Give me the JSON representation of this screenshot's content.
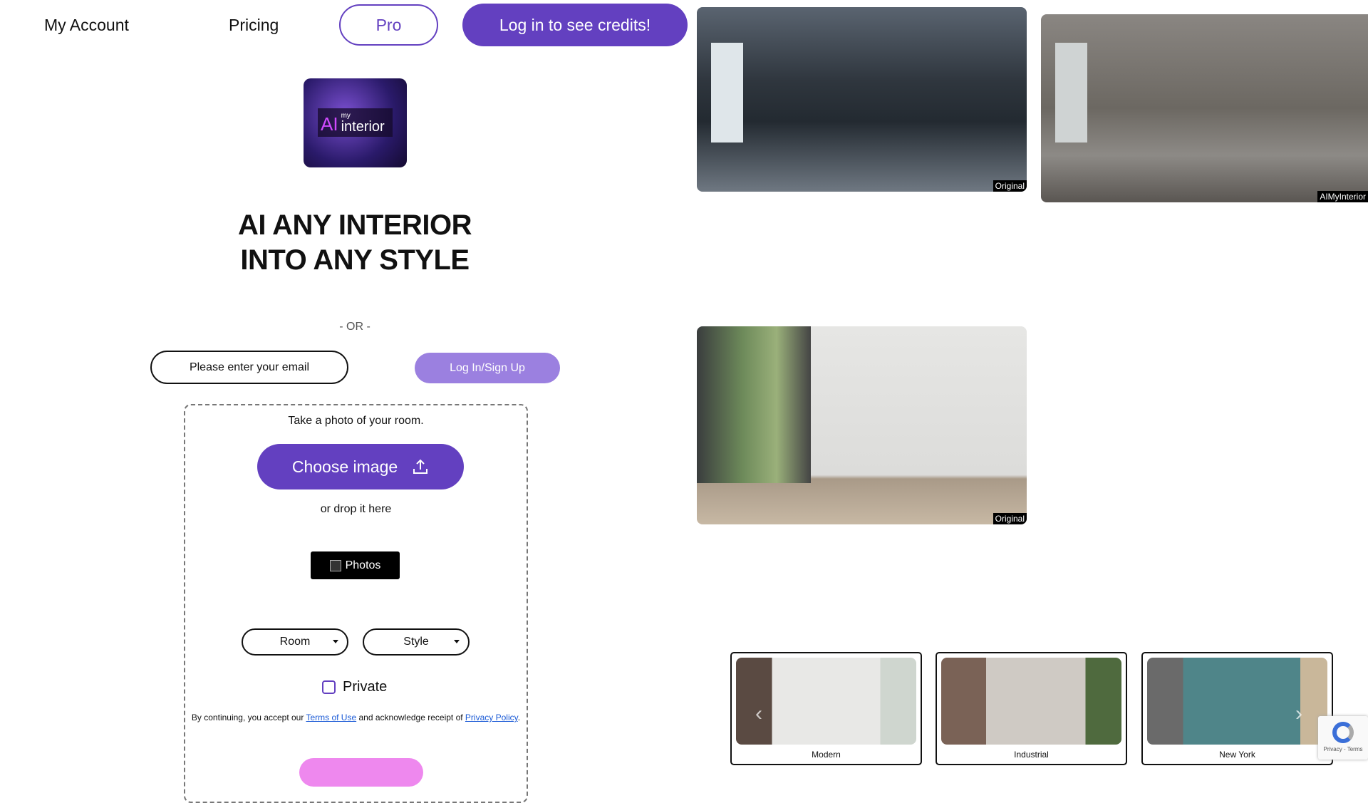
{
  "nav": {
    "my_account": "My Account",
    "pricing": "Pricing",
    "pro": "Pro",
    "credits": "Log in to see credits!"
  },
  "logo": {
    "text_ai": "AI",
    "text_my": "my",
    "text_interior": "interior"
  },
  "hero": {
    "line1": "AI ANY INTERIOR",
    "line2": "INTO ANY STYLE"
  },
  "auth": {
    "or": "- OR -",
    "email_placeholder": "Please enter your email",
    "signup": "Log In/Sign Up"
  },
  "upload": {
    "take": "Take a photo of your room.",
    "choose": "Choose image",
    "drop": "or drop it here",
    "photos": "Photos",
    "room": "Room",
    "style": "Style",
    "private": "Private",
    "legal_pre": "By continuing, you accept our ",
    "terms": "Terms of Use",
    "legal_mid": " and acknowledge receipt of ",
    "privacy": "Privacy Policy",
    "legal_end": "."
  },
  "gallery": {
    "tag_original": "Original",
    "tag_result": "AIMyInterior"
  },
  "styles": [
    {
      "label": "Modern"
    },
    {
      "label": "Industrial"
    },
    {
      "label": "New York"
    }
  ],
  "recaptcha": {
    "text": "Privacy - Terms"
  },
  "colors": {
    "accent": "#6340c0",
    "light_accent": "#9b80e0",
    "pink": "#ee88ee"
  }
}
